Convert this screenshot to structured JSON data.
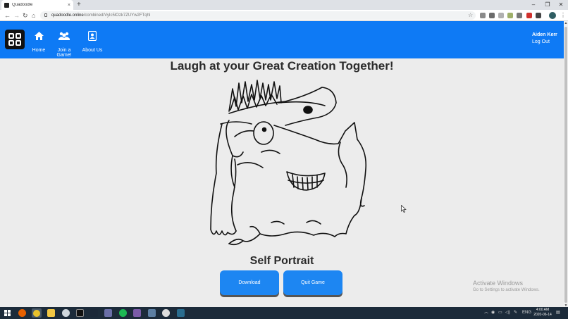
{
  "browser": {
    "tab_title": "Quadoodle",
    "tab_close": "×",
    "new_tab": "+",
    "url_host": "quadoodle.online",
    "url_path": "/combined/VyIc5lOzk7ZUYw2FTqhI",
    "window_controls": [
      "–",
      "❐",
      "✕"
    ],
    "nav": {
      "back": "←",
      "forward": "→",
      "reload": "↻",
      "home": "⌂"
    },
    "star": "☆",
    "menu": "⋮"
  },
  "app": {
    "nav": [
      {
        "label": "Home",
        "icon": "home-icon"
      },
      {
        "label": "Join a Game!",
        "icon": "users-icon"
      },
      {
        "label": "About Us",
        "icon": "user-card-icon"
      }
    ],
    "user_name": "Aiden Kerr",
    "logout_label": "Log Out"
  },
  "main": {
    "heading": "Laugh at your Great Creation Together!",
    "caption": "Self Portrait",
    "download_label": "Download",
    "quit_label": "Quit Game"
  },
  "watermark": {
    "title": "Activate Windows",
    "subtitle": "Go to Settings to activate Windows."
  },
  "taskbar": {
    "lang": "ENG",
    "time": "4:00 AM",
    "date": "2020-06-14"
  },
  "colors": {
    "app_header": "#0e7af5",
    "button": "#1d86f2",
    "page_bg": "#ececec",
    "taskbar": "#1c2b3a"
  }
}
